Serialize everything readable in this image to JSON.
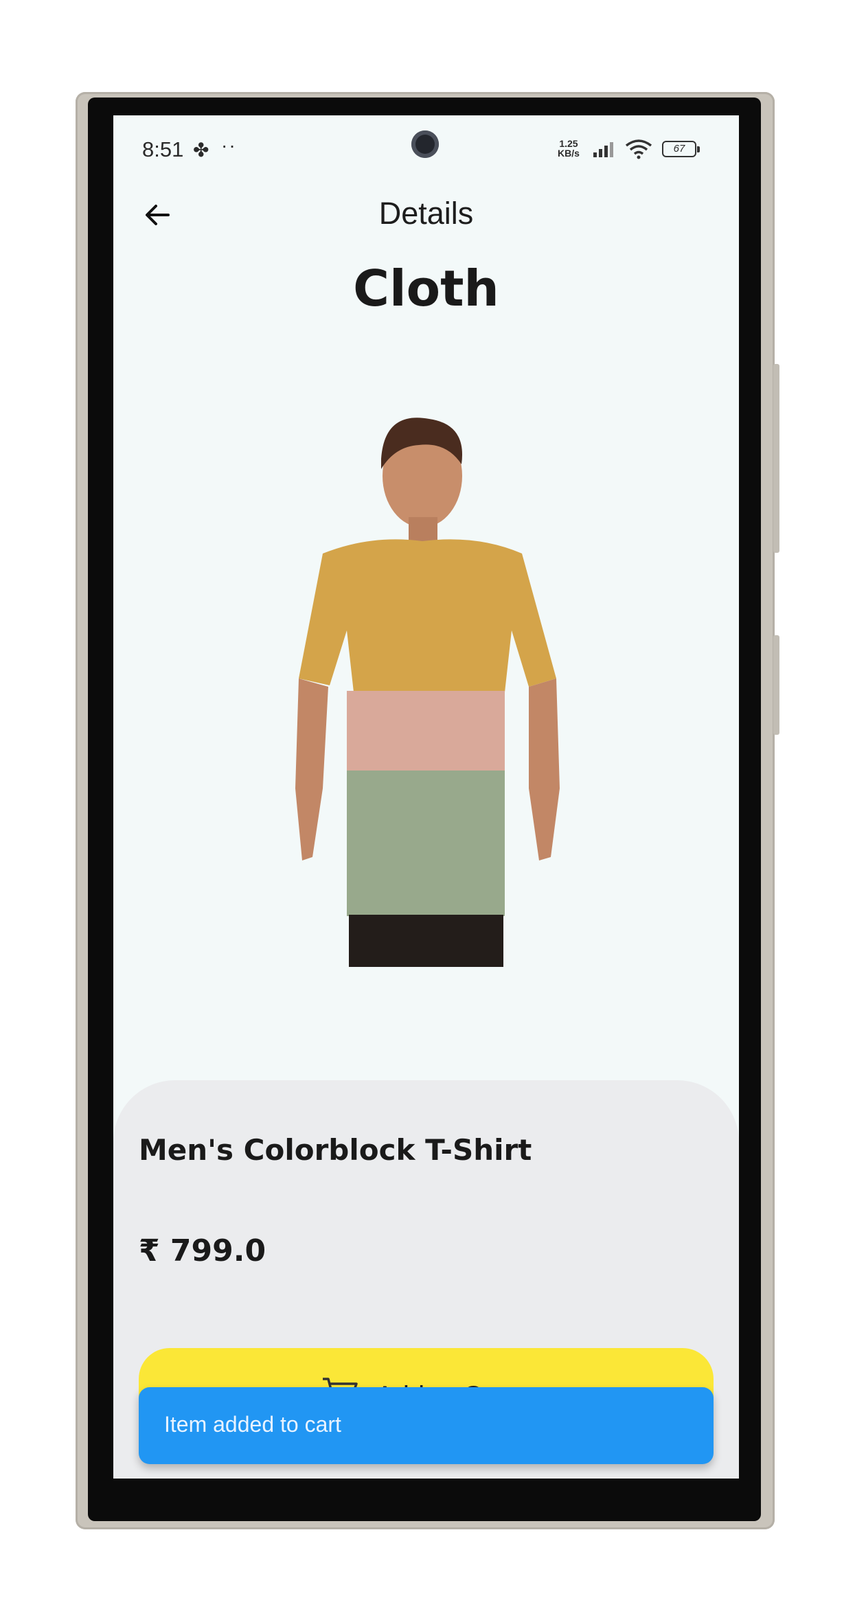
{
  "status_bar": {
    "time": "8:51",
    "dots": "··",
    "network_speed_value": "1.25",
    "network_speed_unit": "KB/s",
    "battery": "67"
  },
  "header": {
    "title": "Details",
    "back_icon": "arrow-left-icon"
  },
  "page": {
    "title": "Cloth"
  },
  "product": {
    "name": "Men's Colorblock T-Shirt",
    "price": "₹ 799.0",
    "image_colors": [
      "#d4a44a",
      "#d9a99a",
      "#98a98c"
    ]
  },
  "cart_button": {
    "label": "Add to Cart",
    "icon": "cart-icon",
    "color": "#fbe737"
  },
  "snackbar": {
    "message": "Item added to cart",
    "color": "#2196f3"
  }
}
